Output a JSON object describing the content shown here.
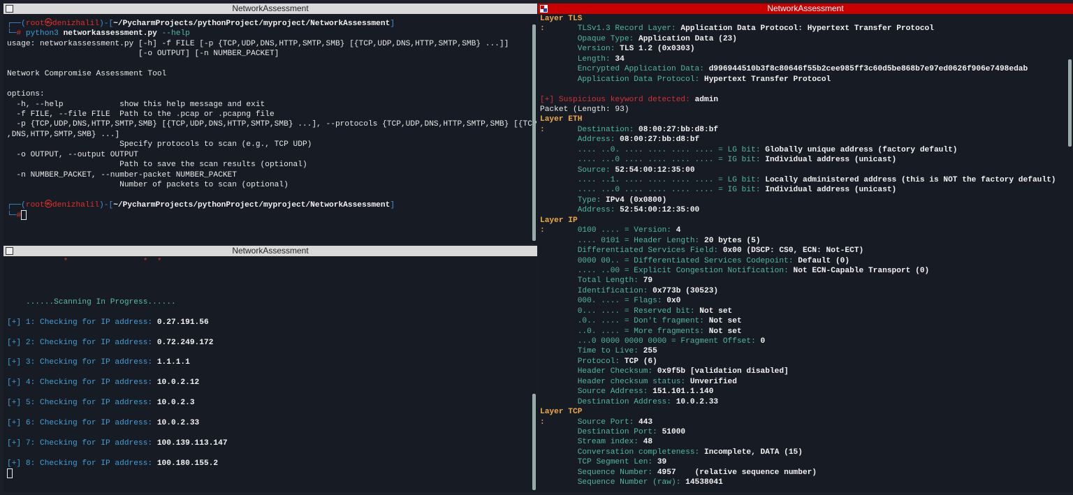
{
  "panes": {
    "top_left": {
      "title": "NetworkAssessment",
      "lines": [
        [
          {
            "c": "b",
            "t": "┌──("
          },
          {
            "c": "r",
            "t": "root㉿denizhalil"
          },
          {
            "c": "b",
            "t": ")-["
          },
          {
            "c": "w",
            "t": "~/PycharmProjects/pythonProject/myproject/NetworkAssessment"
          },
          {
            "c": "b",
            "t": "]"
          }
        ],
        [
          {
            "c": "b",
            "t": "└─"
          },
          {
            "c": "r",
            "t": "#"
          },
          {
            "c": "cy",
            "t": " python3"
          },
          {
            "c": "w",
            "t": " networkassessment.py"
          },
          {
            "c": "t",
            "t": " --help"
          }
        ],
        [
          {
            "c": "p",
            "t": "usage: networkassessment.py [-h] -f FILE [-p {TCP,UDP,DNS,HTTP,SMTP,SMB} [{TCP,UDP,DNS,HTTP,SMTP,SMB} ...]]"
          }
        ],
        [
          {
            "c": "p",
            "t": "                            [-o OUTPUT] [-n NUMBER_PACKET]"
          }
        ],
        [],
        [
          {
            "c": "p",
            "t": "Network Compromise Assessment Tool"
          }
        ],
        [],
        [
          {
            "c": "p",
            "t": "options:"
          }
        ],
        [
          {
            "c": "p",
            "t": "  -h, --help            show this help message and exit"
          }
        ],
        [
          {
            "c": "p",
            "t": "  -f FILE, --file FILE  Path to the .pcap or .pcapng file"
          }
        ],
        [
          {
            "c": "p",
            "t": "  -p {TCP,UDP,DNS,HTTP,SMTP,SMB} [{TCP,UDP,DNS,HTTP,SMTP,SMB} ...], --protocols {TCP,UDP,DNS,HTTP,SMTP,SMB} [{TCP,UDP"
          }
        ],
        [
          {
            "c": "p",
            "t": ",DNS,HTTP,SMTP,SMB} ...]"
          }
        ],
        [
          {
            "c": "p",
            "t": "                        Specify protocols to scan (e.g., TCP UDP)"
          }
        ],
        [
          {
            "c": "p",
            "t": "  -o OUTPUT, --output OUTPUT"
          }
        ],
        [
          {
            "c": "p",
            "t": "                        Path to save the scan results (optional)"
          }
        ],
        [
          {
            "c": "p",
            "t": "  -n NUMBER_PACKET, --number-packet NUMBER_PACKET"
          }
        ],
        [
          {
            "c": "p",
            "t": "                        Number of packets to scan (optional)"
          }
        ],
        [],
        [
          {
            "c": "b",
            "t": "┌──("
          },
          {
            "c": "r",
            "t": "root㉿denizhalil"
          },
          {
            "c": "b",
            "t": ")-["
          },
          {
            "c": "w",
            "t": "~/PycharmProjects/pythonProject/myproject/NetworkAssessment"
          },
          {
            "c": "b",
            "t": "]"
          }
        ],
        [
          {
            "c": "b",
            "t": "└─"
          },
          {
            "c": "r",
            "t": "#"
          },
          {
            "c": "cursor",
            "t": ""
          }
        ]
      ]
    },
    "bottom_left": {
      "title": "NetworkAssessment",
      "lines": [
        [
          {
            "c": "rd",
            "t": "            *                *  *"
          }
        ],
        [],
        [],
        [],
        [
          {
            "c": "g",
            "t": "    ......Scanning In Progress......"
          }
        ],
        [],
        [
          {
            "c": "cy",
            "t": "[+] 1: Checking for IP address: "
          },
          {
            "c": "w",
            "t": "0.27.191.56"
          }
        ],
        [],
        [
          {
            "c": "cy",
            "t": "[+] 2: Checking for IP address: "
          },
          {
            "c": "w",
            "t": "0.72.249.172"
          }
        ],
        [],
        [
          {
            "c": "cy",
            "t": "[+] 3: Checking for IP address: "
          },
          {
            "c": "w",
            "t": "1.1.1.1"
          }
        ],
        [],
        [
          {
            "c": "cy",
            "t": "[+] 4: Checking for IP address: "
          },
          {
            "c": "w",
            "t": "10.0.2.12"
          }
        ],
        [],
        [
          {
            "c": "cy",
            "t": "[+] 5: Checking for IP address: "
          },
          {
            "c": "w",
            "t": "10.0.2.3"
          }
        ],
        [],
        [
          {
            "c": "cy",
            "t": "[+] 6: Checking for IP address: "
          },
          {
            "c": "w",
            "t": "10.0.2.33"
          }
        ],
        [],
        [
          {
            "c": "cy",
            "t": "[+] 7: Checking for IP address: "
          },
          {
            "c": "w",
            "t": "100.139.113.147"
          }
        ],
        [],
        [
          {
            "c": "cy",
            "t": "[+] 8: Checking for IP address: "
          },
          {
            "c": "w",
            "t": "100.180.155.2"
          }
        ],
        [
          {
            "c": "cursor",
            "t": ""
          }
        ]
      ]
    },
    "right": {
      "title": "NetworkAssessment",
      "lines": [
        [
          {
            "c": "o",
            "t": "Layer TLS"
          }
        ],
        [
          {
            "c": "o",
            "t": ":       "
          },
          {
            "c": "t",
            "t": "TLSv1.3 Record Layer: "
          },
          {
            "c": "w",
            "t": "Application Data Protocol: Hypertext Transfer Protocol"
          }
        ],
        [
          {
            "c": "t",
            "t": "        Opaque Type: "
          },
          {
            "c": "w",
            "t": "Application Data (23)"
          }
        ],
        [
          {
            "c": "t",
            "t": "        Version: "
          },
          {
            "c": "w",
            "t": "TLS 1.2 (0x0303)"
          }
        ],
        [
          {
            "c": "t",
            "t": "        Length: "
          },
          {
            "c": "w",
            "t": "34"
          }
        ],
        [
          {
            "c": "t",
            "t": "        Encrypted Application Data: "
          },
          {
            "c": "w",
            "t": "d996944510b3f8c80646f55b2cee985ff3c60d5be868b7e97ed0626f906e7498edab"
          }
        ],
        [
          {
            "c": "t",
            "t": "        Application Data Protocol: "
          },
          {
            "c": "w",
            "t": "Hypertext Transfer Protocol"
          }
        ],
        [],
        [
          {
            "c": "rd",
            "t": "[+] Suspicious keyword detected: "
          },
          {
            "c": "w",
            "t": "admin"
          }
        ],
        [
          {
            "c": "p",
            "t": "Packet (Length: 93)"
          }
        ],
        [
          {
            "c": "o",
            "t": "Layer ETH"
          }
        ],
        [
          {
            "c": "o",
            "t": ":       "
          },
          {
            "c": "t",
            "t": "Destination: "
          },
          {
            "c": "w",
            "t": "08:00:27:bb:d8:bf"
          }
        ],
        [
          {
            "c": "t",
            "t": "        Address: "
          },
          {
            "c": "w",
            "t": "08:00:27:bb:d8:bf"
          }
        ],
        [
          {
            "c": "t",
            "t": "        .... ..0. .... .... .... .... = LG bit: "
          },
          {
            "c": "w",
            "t": "Globally unique address (factory default)"
          }
        ],
        [
          {
            "c": "t",
            "t": "        .... ...0 .... .... .... .... = IG bit: "
          },
          {
            "c": "w",
            "t": "Individual address (unicast)"
          }
        ],
        [
          {
            "c": "t",
            "t": "        Source: "
          },
          {
            "c": "w",
            "t": "52:54:00:12:35:00"
          }
        ],
        [
          {
            "c": "t",
            "t": "        .... ..1. .... .... .... .... = LG bit: "
          },
          {
            "c": "w",
            "t": "Locally administered address (this is NOT the factory default)"
          }
        ],
        [
          {
            "c": "t",
            "t": "        .... ...0 .... .... .... .... = IG bit: "
          },
          {
            "c": "w",
            "t": "Individual address (unicast)"
          }
        ],
        [
          {
            "c": "t",
            "t": "        Type: "
          },
          {
            "c": "w",
            "t": "IPv4 (0x0800)"
          }
        ],
        [
          {
            "c": "t",
            "t": "        Address: "
          },
          {
            "c": "w",
            "t": "52:54:00:12:35:00"
          }
        ],
        [
          {
            "c": "o",
            "t": "Layer IP"
          }
        ],
        [
          {
            "c": "o",
            "t": ":       "
          },
          {
            "c": "t",
            "t": "0100 .... = Version: "
          },
          {
            "c": "w",
            "t": "4"
          }
        ],
        [
          {
            "c": "t",
            "t": "        .... 0101 = Header Length: "
          },
          {
            "c": "w",
            "t": "20 bytes (5)"
          }
        ],
        [
          {
            "c": "t",
            "t": "        Differentiated Services Field: "
          },
          {
            "c": "w",
            "t": "0x00 (DSCP: CS0, ECN: Not-ECT)"
          }
        ],
        [
          {
            "c": "t",
            "t": "        0000 00.. = Differentiated Services Codepoint: "
          },
          {
            "c": "w",
            "t": "Default (0)"
          }
        ],
        [
          {
            "c": "t",
            "t": "        .... ..00 = Explicit Congestion Notification: "
          },
          {
            "c": "w",
            "t": "Not ECN-Capable Transport (0)"
          }
        ],
        [
          {
            "c": "t",
            "t": "        Total Length: "
          },
          {
            "c": "w",
            "t": "79"
          }
        ],
        [
          {
            "c": "t",
            "t": "        Identification: "
          },
          {
            "c": "w",
            "t": "0x773b (30523)"
          }
        ],
        [
          {
            "c": "t",
            "t": "        000. .... = Flags: "
          },
          {
            "c": "w",
            "t": "0x0"
          }
        ],
        [
          {
            "c": "t",
            "t": "        0... .... = Reserved bit: "
          },
          {
            "c": "w",
            "t": "Not set"
          }
        ],
        [
          {
            "c": "t",
            "t": "        .0.. .... = Don't fragment: "
          },
          {
            "c": "w",
            "t": "Not set"
          }
        ],
        [
          {
            "c": "t",
            "t": "        ..0. .... = More fragments: "
          },
          {
            "c": "w",
            "t": "Not set"
          }
        ],
        [
          {
            "c": "t",
            "t": "        ...0 0000 0000 0000 = Fragment Offset: "
          },
          {
            "c": "w",
            "t": "0"
          }
        ],
        [
          {
            "c": "t",
            "t": "        Time to Live: "
          },
          {
            "c": "w",
            "t": "255"
          }
        ],
        [
          {
            "c": "t",
            "t": "        Protocol: "
          },
          {
            "c": "w",
            "t": "TCP (6)"
          }
        ],
        [
          {
            "c": "t",
            "t": "        Header Checksum: "
          },
          {
            "c": "w",
            "t": "0x9f5b [validation disabled]"
          }
        ],
        [
          {
            "c": "t",
            "t": "        Header checksum status: "
          },
          {
            "c": "w",
            "t": "Unverified"
          }
        ],
        [
          {
            "c": "t",
            "t": "        Source Address: "
          },
          {
            "c": "w",
            "t": "151.101.1.140"
          }
        ],
        [
          {
            "c": "t",
            "t": "        Destination Address: "
          },
          {
            "c": "w",
            "t": "10.0.2.33"
          }
        ],
        [
          {
            "c": "o",
            "t": "Layer TCP"
          }
        ],
        [
          {
            "c": "o",
            "t": ":       "
          },
          {
            "c": "t",
            "t": "Source Port: "
          },
          {
            "c": "w",
            "t": "443"
          }
        ],
        [
          {
            "c": "t",
            "t": "        Destination Port: "
          },
          {
            "c": "w",
            "t": "51000"
          }
        ],
        [
          {
            "c": "t",
            "t": "        Stream index: "
          },
          {
            "c": "w",
            "t": "48"
          }
        ],
        [
          {
            "c": "t",
            "t": "        Conversation completeness: "
          },
          {
            "c": "w",
            "t": "Incomplete, DATA (15)"
          }
        ],
        [
          {
            "c": "t",
            "t": "        TCP Segment Len: "
          },
          {
            "c": "w",
            "t": "39"
          }
        ],
        [
          {
            "c": "t",
            "t": "        Sequence Number: "
          },
          {
            "c": "w",
            "t": "4957    (relative sequence number)"
          }
        ],
        [
          {
            "c": "t",
            "t": "        Sequence Number (raw): "
          },
          {
            "c": "w",
            "t": "14538041"
          }
        ]
      ]
    }
  },
  "colors": {
    "active_titlebar": "#c80000",
    "inactive_titlebar": "#d9d9d9",
    "background": "#171b23",
    "key": "#4fb8a4",
    "layer": "#f0a848",
    "alert": "#d83030",
    "prompt": "#3f8fe0"
  },
  "icons": {
    "titlebar": "terminal-layout-icon"
  }
}
